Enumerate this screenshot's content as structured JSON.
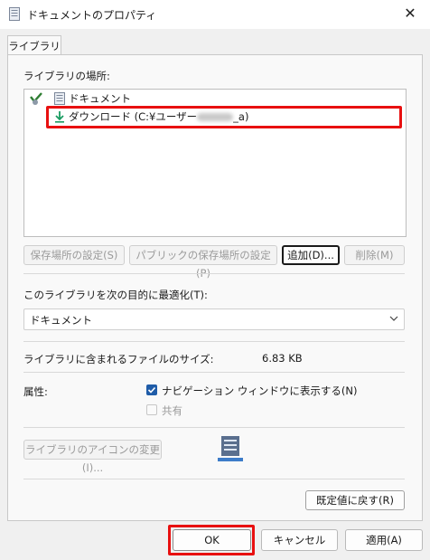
{
  "window": {
    "title": "ドキュメントのプロパティ",
    "close_label": "✕"
  },
  "tabs": [
    {
      "label": "ライブラリ"
    }
  ],
  "library_locations": {
    "label": "ライブラリの場所:",
    "items": [
      {
        "label": "ドキュメント"
      },
      {
        "label_prefix": "ダウンロード (C:¥ユーザー",
        "label_suffix": "_a)"
      }
    ]
  },
  "location_buttons": {
    "set_save": "保存場所の設定(S)",
    "set_public": "パブリックの保存場所の設定(P)",
    "add": "追加(D)...",
    "remove": "削除(M)"
  },
  "optimize": {
    "label": "このライブラリを次の目的に最適化(T):",
    "value": "ドキュメント"
  },
  "size": {
    "label": "ライブラリに含まれるファイルのサイズ:",
    "value": "6.83 KB"
  },
  "attributes": {
    "label": "属性:",
    "show_nav": {
      "label": "ナビゲーション ウィンドウに表示する(N)",
      "checked": true
    },
    "shared": {
      "label": "共有",
      "checked": false
    }
  },
  "change_icon": "ライブラリのアイコンの変更(I)...",
  "restore_defaults": "既定値に戻す(R)",
  "footer": {
    "ok": "OK",
    "cancel": "キャンセル",
    "apply": "適用(A)"
  },
  "colors": {
    "highlight_red": "#e81010",
    "check_blue": "#1f5ca8"
  }
}
